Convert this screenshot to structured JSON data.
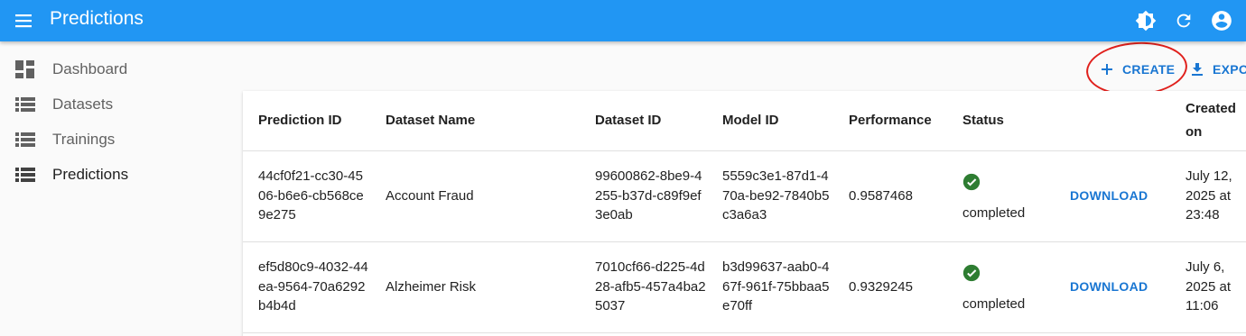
{
  "appbar": {
    "title": "Predictions",
    "icons": [
      "menu-icon",
      "brightness-icon",
      "refresh-icon",
      "account-icon"
    ],
    "color": "#2196f3"
  },
  "sidebar": {
    "items": [
      {
        "label": "Dashboard",
        "icon": "dashboard-icon"
      },
      {
        "label": "Datasets",
        "icon": "list-icon"
      },
      {
        "label": "Trainings",
        "icon": "list-icon"
      },
      {
        "label": "Predictions",
        "icon": "list-icon",
        "active": true
      }
    ]
  },
  "toolbar": {
    "create_label": "CREATE",
    "export_label": "EXPO",
    "accent": "#1976d2",
    "highlight_color": "#e0201c"
  },
  "table": {
    "headers": {
      "prediction_id": "Prediction ID",
      "dataset_name": "Dataset Name",
      "dataset_id": "Dataset ID",
      "model_id": "Model ID",
      "performance": "Performance",
      "status": "Status",
      "created_on": "Created on"
    },
    "rows": [
      {
        "prediction_id": "44cf0f21-cc30-4506-b6e6-cb568ce9e275",
        "dataset_name": "Account Fraud",
        "dataset_id": "99600862-8be9-4255-b37d-c89f9ef3e0ab",
        "model_id": "5559c3e1-87d1-470a-be92-7840b5c3a6a3",
        "performance": "0.9587468",
        "status": "completed",
        "download": "DOWNLOAD",
        "created_on": "July 12, 2025 at 23:48"
      },
      {
        "prediction_id": "ef5d80c9-4032-44ea-9564-70a6292b4b4d",
        "dataset_name": "Alzheimer Risk",
        "dataset_id": "7010cf66-d225-4d28-afb5-457a4ba25037",
        "model_id": "b3d99637-aab0-467f-961f-75bbaa5e70ff",
        "performance": "0.9329245",
        "status": "completed",
        "download": "DOWNLOAD",
        "created_on": "July 6, 2025 at 11:06"
      }
    ],
    "status_color": "#2e7d32"
  }
}
